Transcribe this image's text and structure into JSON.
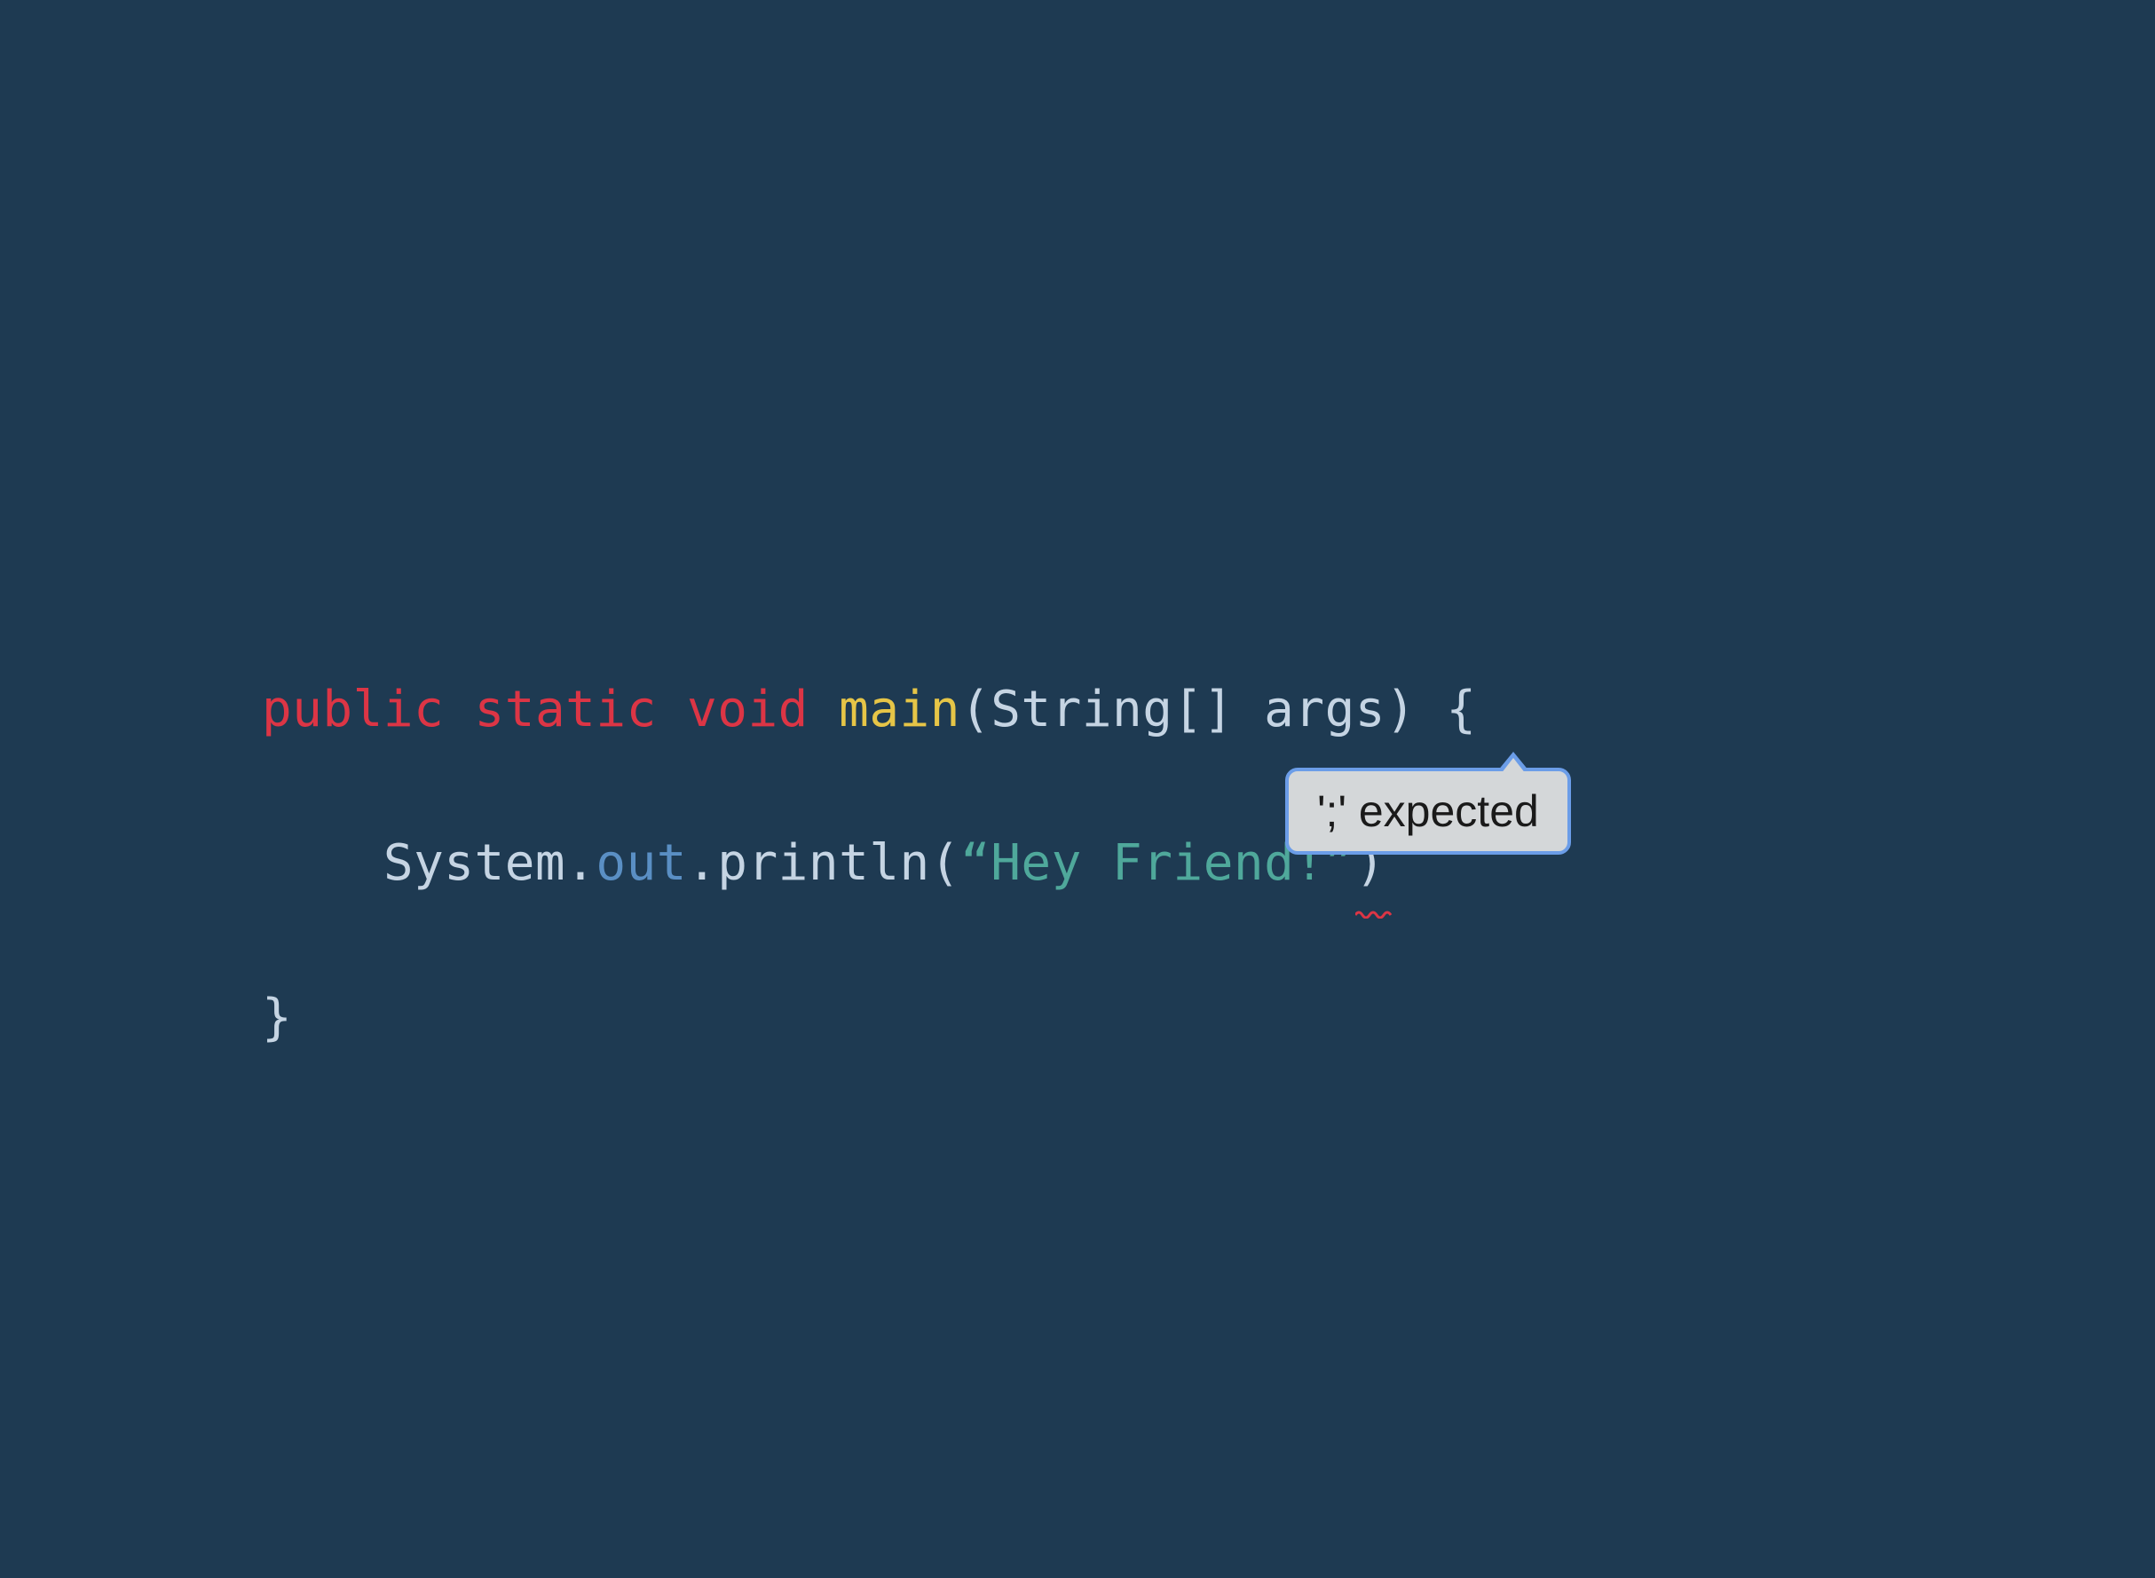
{
  "code": {
    "line1": {
      "kw_public": "public",
      "kw_static": "static",
      "kw_void": "void",
      "method": "main",
      "paren_open": "(",
      "type": "String",
      "brackets": "[]",
      "space": " ",
      "param": "args",
      "paren_close": ")",
      "brace_open": " {"
    },
    "line2": {
      "indent": "    ",
      "system": "System",
      "dot1": ".",
      "out": "out",
      "dot2": ".",
      "println": "println",
      "paren_open": "(",
      "string": "“Hey Friend!”",
      "paren_close": ")"
    },
    "line3": {
      "brace_close": "}"
    }
  },
  "error": {
    "message": "';' expected"
  },
  "colors": {
    "background": "#1e3a52",
    "keyword": "#dc3545",
    "method": "#e6c547",
    "identifier": "#c5d4e3",
    "field": "#5a8fc4",
    "string": "#4fa89b",
    "tooltip_bg": "#d4d7d9",
    "tooltip_border": "#6b9de8",
    "error_squiggle": "#dc3545"
  }
}
